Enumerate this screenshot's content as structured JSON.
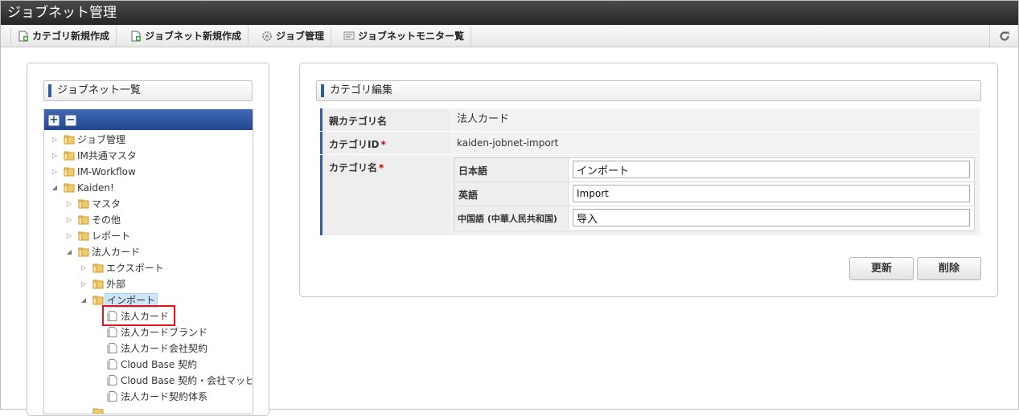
{
  "app": {
    "title": "ジョブネット管理"
  },
  "toolbar": {
    "new_category": "カテゴリ新規作成",
    "new_jobnet": "ジョブネット新規作成",
    "job_manage": "ジョブ管理",
    "jobnet_monitor": "ジョブネットモニター覧"
  },
  "left": {
    "heading": "ジョブネット一覧",
    "expand": "+",
    "collapse": "−"
  },
  "tree": {
    "n0": "ジョブ管理",
    "n1": "IM共通マスタ",
    "n2": "IM-Workflow",
    "n3": "Kaiden!",
    "n4": "マスタ",
    "n5": "その他",
    "n6": "レポート",
    "n7": "法人カード",
    "n8": "エクスポート",
    "n9": "外部",
    "n10": "インポート",
    "n11": "法人カード",
    "n12": "法人カードブランド",
    "n13": "法人カード会社契約",
    "n14": "Cloud Base 契約",
    "n15": "Cloud Base 契約・会社マッピ",
    "n16": "法人カード契約体系"
  },
  "form": {
    "heading": "カテゴリ編集",
    "parent_label": "親カテゴリ名",
    "parent_value": "法人カード",
    "id_label": "カテゴリID",
    "id_value": "kaiden-jobnet-import",
    "name_label": "カテゴリ名",
    "required_mark": "*",
    "langs": {
      "ja_label": "日本語",
      "ja_value": "インポート",
      "en_label": "英語",
      "en_value": "Import",
      "zh_label": "中国語 (中華人民共和国)",
      "zh_value": "导入"
    },
    "update_button": "更新",
    "delete_button": "削除"
  },
  "colors": {
    "accent": "#2f5d9e",
    "tree_header": "#23478f",
    "required": "#d40000",
    "highlight": "#e0141e"
  }
}
